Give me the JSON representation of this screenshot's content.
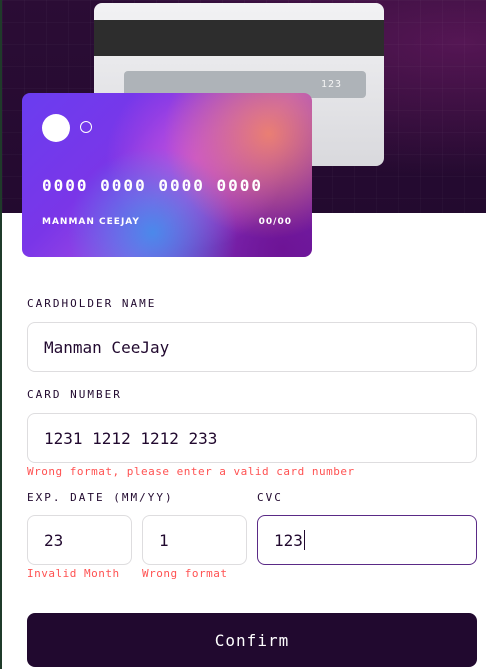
{
  "card_back": {
    "cvc": "123"
  },
  "card_front": {
    "number": "0000 0000 0000 0000",
    "name": "MANMAN CEEJAY",
    "expiry": "00/00"
  },
  "form": {
    "cardholder_label": "CARDHOLDER NAME",
    "cardholder_value": "Manman CeeJay",
    "number_label": "CARD NUMBER",
    "number_value": "1231 1212 1212 233",
    "number_error": "Wrong format, please enter a valid card number",
    "expiry_label": "EXP. DATE (MM/YY)",
    "month_value": "23",
    "month_error": "Invalid Month",
    "year_value": "1",
    "year_error": "Wrong format",
    "cvc_label": "CVC",
    "cvc_value": "123",
    "confirm_label": "Confirm"
  },
  "colors": {
    "primary": "#21092f",
    "error": "#ff5252",
    "active_border": "#5a2a86"
  }
}
